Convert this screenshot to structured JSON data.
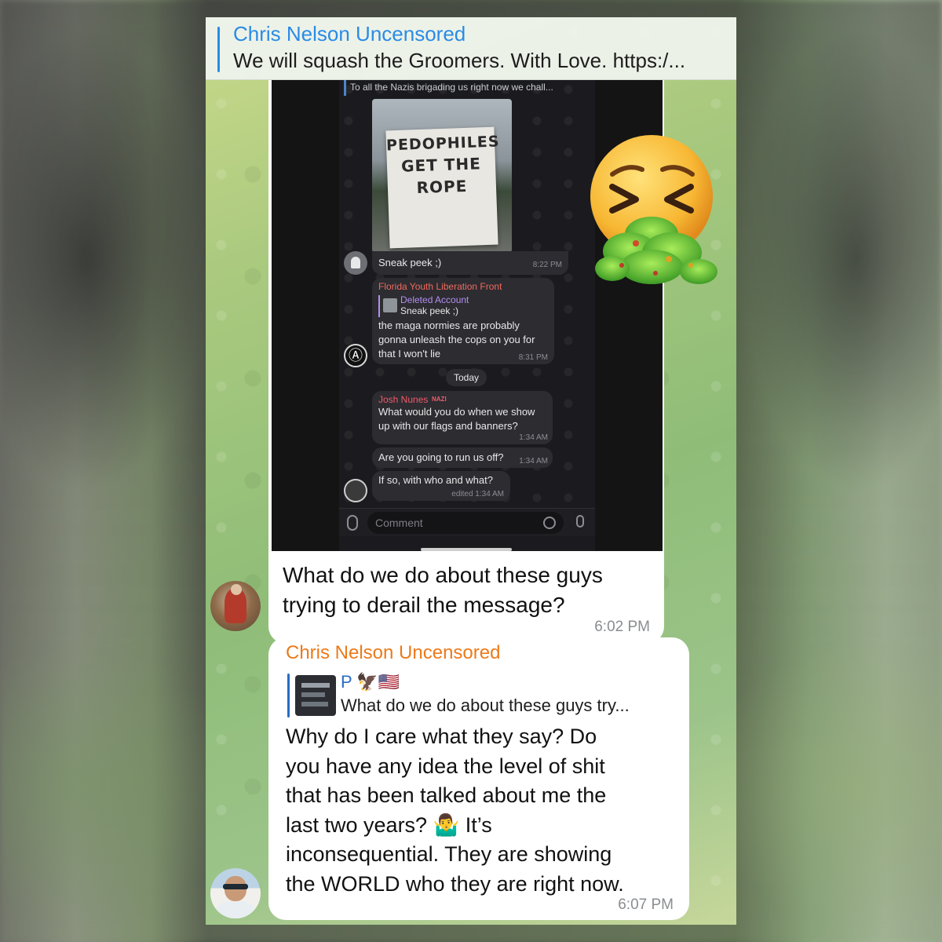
{
  "pinned": {
    "title": "Chris Nelson Uncensored",
    "text": "We will squash the Groomers. With Love. https:/..."
  },
  "screenshot": {
    "top_caption": "To all the Nazis brigading us right now we chall...",
    "banner": {
      "line1": "PEDOPHILES",
      "line2": "GET THE",
      "line3": "ROPE"
    },
    "msg_sneak": {
      "text": "Sneak peek ;)",
      "time": "8:22 PM"
    },
    "msg_flf": {
      "sender": "Florida Youth Liberation Front",
      "reply_sender": "Deleted Account",
      "reply_text": "Sneak peek ;)",
      "line1": "the maga normies are probably",
      "line2": "gonna unleash the cops on you for",
      "line3": "that I won't lie",
      "time": "8:31 PM"
    },
    "divider": "Today",
    "msg_josh": {
      "sender": "Josh Nunes",
      "badge": "NAZI",
      "line1": "What would you do when we show",
      "line2": "up with our flags and banners?",
      "time": "1:34 AM"
    },
    "msg_run": {
      "text": "Are you going to run us off?",
      "time": "1:34 AM"
    },
    "msg_who": {
      "text": "If so, with who and what?",
      "time": "edited 1:34 AM"
    },
    "comment_placeholder": "Comment"
  },
  "message1": {
    "caption_line1": "What do we do about these guys",
    "caption_line2": "trying to derail the message?",
    "time": "6:02 PM"
  },
  "message2": {
    "sender": "Chris Nelson Uncensored",
    "reply_sender": "P 🦅🇺🇸",
    "reply_text": "What do we do about these guys try...",
    "lines": [
      "Why do I care what they say? Do",
      "you have any idea the level of shit",
      "that has been talked about me the",
      "last two years? 🤷‍♂️ It’s",
      "inconsequential. They are showing",
      "the WORLD who they are right now."
    ],
    "time": "6:07 PM"
  },
  "sticker": {
    "icon": "vomiting-face-icon"
  },
  "colors": {
    "link_blue": "#2a8be6",
    "sender_orange": "#ec7a1a",
    "reply_blue": "#2a6cc4",
    "flf_red": "#ef6a5e",
    "deleted_purple": "#b48ef0",
    "josh_red": "#ef5b6a"
  }
}
